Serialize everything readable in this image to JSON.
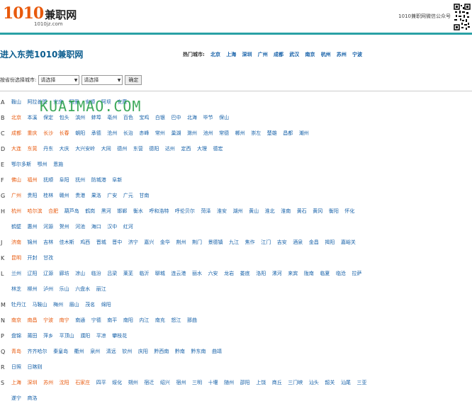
{
  "header": {
    "logo_num": "1010",
    "logo_cn": "兼职网",
    "logo_sub": "1010jz.com",
    "wechat_text": "1010兼职网微信公众号"
  },
  "title": "进入东莞1010兼职网",
  "hot": {
    "label": "热门城市:",
    "cities": [
      "北京",
      "上海",
      "深圳",
      "广州",
      "成都",
      "武汉",
      "南京",
      "杭州",
      "苏州",
      "宁波"
    ]
  },
  "selector": {
    "label": "按省份选择城市:",
    "province": "请选择",
    "city": "请选择",
    "submit": "确定"
  },
  "watermark": "KUAIMAO.COM",
  "groups": [
    {
      "letter": "A",
      "cities": [
        {
          "n": "鞍山",
          "h": 0
        },
        {
          "n": "阿拉善盟",
          "h": 0
        },
        {
          "n": "安庆",
          "h": 0
        },
        {
          "n": "阿里",
          "h": 0
        },
        {
          "n": "安顺",
          "h": 0
        },
        {
          "n": "阿坝",
          "h": 0
        },
        {
          "n": "安康",
          "h": 0
        }
      ]
    },
    {
      "letter": "B",
      "cities": [
        {
          "n": "北京",
          "h": 1
        },
        {
          "n": "本溪",
          "h": 0
        },
        {
          "n": "保定",
          "h": 0
        },
        {
          "n": "包头",
          "h": 0
        },
        {
          "n": "滨州",
          "h": 0
        },
        {
          "n": "蚌埠",
          "h": 0
        },
        {
          "n": "亳州",
          "h": 0
        },
        {
          "n": "百色",
          "h": 0
        },
        {
          "n": "宝鸡",
          "h": 0
        },
        {
          "n": "白银",
          "h": 0
        },
        {
          "n": "巴中",
          "h": 0
        },
        {
          "n": "北海",
          "h": 0
        },
        {
          "n": "毕节",
          "h": 0
        },
        {
          "n": "保山",
          "h": 0
        }
      ]
    },
    {
      "letter": "C",
      "cities": [
        {
          "n": "成都",
          "h": 1
        },
        {
          "n": "重庆",
          "h": 1
        },
        {
          "n": "长沙",
          "h": 1
        },
        {
          "n": "长春",
          "h": 1
        },
        {
          "n": "朝阳",
          "h": 0
        },
        {
          "n": "承德",
          "h": 0
        },
        {
          "n": "沧州",
          "h": 0
        },
        {
          "n": "长治",
          "h": 0
        },
        {
          "n": "赤峰",
          "h": 0
        },
        {
          "n": "常州",
          "h": 0
        },
        {
          "n": "巢湖",
          "h": 0
        },
        {
          "n": "滁州",
          "h": 0
        },
        {
          "n": "池州",
          "h": 0
        },
        {
          "n": "常德",
          "h": 0
        },
        {
          "n": "郴州",
          "h": 0
        },
        {
          "n": "崇左",
          "h": 0
        },
        {
          "n": "楚雄",
          "h": 0
        },
        {
          "n": "昌都",
          "h": 0
        },
        {
          "n": "潮州",
          "h": 0
        }
      ]
    },
    {
      "letter": "D",
      "cities": [
        {
          "n": "大连",
          "h": 1
        },
        {
          "n": "东莞",
          "h": 1
        },
        {
          "n": "丹东",
          "h": 0
        },
        {
          "n": "大庆",
          "h": 0
        },
        {
          "n": "大兴安岭",
          "h": 0
        },
        {
          "n": "大同",
          "h": 0
        },
        {
          "n": "德州",
          "h": 0
        },
        {
          "n": "东营",
          "h": 0
        },
        {
          "n": "德阳",
          "h": 0
        },
        {
          "n": "达州",
          "h": 0
        },
        {
          "n": "定西",
          "h": 0
        },
        {
          "n": "大理",
          "h": 0
        },
        {
          "n": "德宏",
          "h": 0
        }
      ]
    },
    {
      "letter": "E",
      "cities": [
        {
          "n": "鄂尔多斯",
          "h": 0
        },
        {
          "n": "鄂州",
          "h": 0
        },
        {
          "n": "恩施",
          "h": 0
        }
      ]
    },
    {
      "letter": "F",
      "cities": [
        {
          "n": "佛山",
          "h": 1
        },
        {
          "n": "福州",
          "h": 1
        },
        {
          "n": "抚顺",
          "h": 0
        },
        {
          "n": "阜阳",
          "h": 0
        },
        {
          "n": "抚州",
          "h": 0
        },
        {
          "n": "防城港",
          "h": 0
        },
        {
          "n": "阜新",
          "h": 0
        }
      ]
    },
    {
      "letter": "G",
      "cities": [
        {
          "n": "广州",
          "h": 1
        },
        {
          "n": "贵阳",
          "h": 0
        },
        {
          "n": "桂林",
          "h": 0
        },
        {
          "n": "赣州",
          "h": 0
        },
        {
          "n": "贵港",
          "h": 0
        },
        {
          "n": "果洛",
          "h": 0
        },
        {
          "n": "广安",
          "h": 0
        },
        {
          "n": "广元",
          "h": 0
        },
        {
          "n": "甘南",
          "h": 0
        }
      ]
    },
    {
      "letter": "H",
      "tall": true,
      "cities": [
        {
          "n": "杭州",
          "h": 1
        },
        {
          "n": "哈尔滨",
          "h": 1
        },
        {
          "n": "合肥",
          "h": 1
        },
        {
          "n": "葫芦岛",
          "h": 0
        },
        {
          "n": "鹤岗",
          "h": 0
        },
        {
          "n": "黑河",
          "h": 0
        },
        {
          "n": "邯郸",
          "h": 0
        },
        {
          "n": "衡水",
          "h": 0
        },
        {
          "n": "呼和浩特",
          "h": 0
        },
        {
          "n": "呼伦贝尔",
          "h": 0
        },
        {
          "n": "菏泽",
          "h": 0
        },
        {
          "n": "淮安",
          "h": 0
        },
        {
          "n": "湖州",
          "h": 0
        },
        {
          "n": "黄山",
          "h": 0
        },
        {
          "n": "淮北",
          "h": 0
        },
        {
          "n": "淮南",
          "h": 0
        },
        {
          "n": "黄石",
          "h": 0
        },
        {
          "n": "黄冈",
          "h": 0
        },
        {
          "n": "衡阳",
          "h": 0
        },
        {
          "n": "怀化",
          "h": 0
        },
        {
          "n": "鹤壁",
          "h": 0
        },
        {
          "n": "惠州",
          "h": 0
        },
        {
          "n": "河源",
          "h": 0
        },
        {
          "n": "贺州",
          "h": 0
        },
        {
          "n": "河池",
          "h": 0
        },
        {
          "n": "海口",
          "h": 0
        },
        {
          "n": "汉中",
          "h": 0
        },
        {
          "n": "红河",
          "h": 0
        }
      ]
    },
    {
      "letter": "J",
      "cities": [
        {
          "n": "济南",
          "h": 1
        },
        {
          "n": "锦州",
          "h": 0
        },
        {
          "n": "吉林",
          "h": 0
        },
        {
          "n": "佳木斯",
          "h": 0
        },
        {
          "n": "鸡西",
          "h": 0
        },
        {
          "n": "晋城",
          "h": 0
        },
        {
          "n": "晋中",
          "h": 0
        },
        {
          "n": "济宁",
          "h": 0
        },
        {
          "n": "嘉兴",
          "h": 0
        },
        {
          "n": "金华",
          "h": 0
        },
        {
          "n": "荆州",
          "h": 0
        },
        {
          "n": "荆门",
          "h": 0
        },
        {
          "n": "景德镇",
          "h": 0
        },
        {
          "n": "九江",
          "h": 0
        },
        {
          "n": "焦作",
          "h": 0
        },
        {
          "n": "江门",
          "h": 0
        },
        {
          "n": "吉安",
          "h": 0
        },
        {
          "n": "酒泉",
          "h": 0
        },
        {
          "n": "金昌",
          "h": 0
        },
        {
          "n": "揭阳",
          "h": 0
        },
        {
          "n": "嘉峪关",
          "h": 0
        }
      ]
    },
    {
      "letter": "K",
      "cities": [
        {
          "n": "昆明",
          "h": 1
        },
        {
          "n": "开封",
          "h": 0
        },
        {
          "n": "甘孜",
          "h": 0
        }
      ]
    },
    {
      "letter": "L",
      "tall": true,
      "cities": [
        {
          "n": "兰州",
          "h": 0
        },
        {
          "n": "辽阳",
          "h": 0
        },
        {
          "n": "辽源",
          "h": 0
        },
        {
          "n": "廊坊",
          "h": 0
        },
        {
          "n": "凉山",
          "h": 0
        },
        {
          "n": "临汾",
          "h": 0
        },
        {
          "n": "吕梁",
          "h": 0
        },
        {
          "n": "莱芜",
          "h": 0
        },
        {
          "n": "临沂",
          "h": 0
        },
        {
          "n": "聊城",
          "h": 0
        },
        {
          "n": "连云港",
          "h": 0
        },
        {
          "n": "丽水",
          "h": 0
        },
        {
          "n": "六安",
          "h": 0
        },
        {
          "n": "龙岩",
          "h": 0
        },
        {
          "n": "娄底",
          "h": 0
        },
        {
          "n": "洛阳",
          "h": 0
        },
        {
          "n": "漯河",
          "h": 0
        },
        {
          "n": "来宾",
          "h": 0
        },
        {
          "n": "陇南",
          "h": 0
        },
        {
          "n": "临夏",
          "h": 0
        },
        {
          "n": "临沧",
          "h": 0
        },
        {
          "n": "拉萨",
          "h": 0
        },
        {
          "n": "林芝",
          "h": 0
        },
        {
          "n": "柳州",
          "h": 0
        },
        {
          "n": "泸州",
          "h": 0
        },
        {
          "n": "乐山",
          "h": 0
        },
        {
          "n": "六盘水",
          "h": 0
        },
        {
          "n": "丽江",
          "h": 0
        }
      ]
    },
    {
      "letter": "M",
      "cities": [
        {
          "n": "牡丹江",
          "h": 0
        },
        {
          "n": "马鞍山",
          "h": 0
        },
        {
          "n": "梅州",
          "h": 0
        },
        {
          "n": "眉山",
          "h": 0
        },
        {
          "n": "茂名",
          "h": 0
        },
        {
          "n": "绵阳",
          "h": 0
        }
      ]
    },
    {
      "letter": "N",
      "cities": [
        {
          "n": "南京",
          "h": 1
        },
        {
          "n": "南昌",
          "h": 1
        },
        {
          "n": "宁波",
          "h": 1
        },
        {
          "n": "南宁",
          "h": 1
        },
        {
          "n": "南通",
          "h": 0
        },
        {
          "n": "宁德",
          "h": 0
        },
        {
          "n": "南平",
          "h": 0
        },
        {
          "n": "南阳",
          "h": 0
        },
        {
          "n": "内江",
          "h": 0
        },
        {
          "n": "南充",
          "h": 0
        },
        {
          "n": "怒江",
          "h": 0
        },
        {
          "n": "那曲",
          "h": 0
        }
      ]
    },
    {
      "letter": "P",
      "cities": [
        {
          "n": "盘锦",
          "h": 0
        },
        {
          "n": "莆田",
          "h": 0
        },
        {
          "n": "萍乡",
          "h": 0
        },
        {
          "n": "平顶山",
          "h": 0
        },
        {
          "n": "濮阳",
          "h": 0
        },
        {
          "n": "平凉",
          "h": 0
        },
        {
          "n": "攀枝花",
          "h": 0
        }
      ]
    },
    {
      "letter": "Q",
      "cities": [
        {
          "n": "青岛",
          "h": 1
        },
        {
          "n": "齐齐哈尔",
          "h": 0
        },
        {
          "n": "秦皇岛",
          "h": 0
        },
        {
          "n": "衢州",
          "h": 0
        },
        {
          "n": "泉州",
          "h": 0
        },
        {
          "n": "清远",
          "h": 0
        },
        {
          "n": "钦州",
          "h": 0
        },
        {
          "n": "庆阳",
          "h": 0
        },
        {
          "n": "黔西南",
          "h": 0
        },
        {
          "n": "黔南",
          "h": 0
        },
        {
          "n": "黔东南",
          "h": 0
        },
        {
          "n": "曲靖",
          "h": 0
        }
      ]
    },
    {
      "letter": "R",
      "cities": [
        {
          "n": "日照",
          "h": 0
        },
        {
          "n": "日喀则",
          "h": 0
        }
      ]
    },
    {
      "letter": "S",
      "cities": [
        {
          "n": "上海",
          "h": 1
        },
        {
          "n": "深圳",
          "h": 1
        },
        {
          "n": "苏州",
          "h": 1
        },
        {
          "n": "沈阳",
          "h": 1
        },
        {
          "n": "石家庄",
          "h": 1
        },
        {
          "n": "四平",
          "h": 0
        },
        {
          "n": "绥化",
          "h": 0
        },
        {
          "n": "朔州",
          "h": 0
        },
        {
          "n": "宿迁",
          "h": 0
        },
        {
          "n": "绍兴",
          "h": 0
        },
        {
          "n": "宿州",
          "h": 0
        },
        {
          "n": "三明",
          "h": 0
        },
        {
          "n": "十堰",
          "h": 0
        },
        {
          "n": "随州",
          "h": 0
        },
        {
          "n": "邵阳",
          "h": 0
        },
        {
          "n": "上饶",
          "h": 0
        },
        {
          "n": "商丘",
          "h": 0
        },
        {
          "n": "三门峡",
          "h": 0
        },
        {
          "n": "汕头",
          "h": 0
        },
        {
          "n": "韶关",
          "h": 0
        },
        {
          "n": "汕尾",
          "h": 0
        },
        {
          "n": "三亚",
          "h": 0
        },
        {
          "n": "遂宁",
          "h": 0
        },
        {
          "n": "商洛",
          "h": 0
        }
      ]
    }
  ]
}
